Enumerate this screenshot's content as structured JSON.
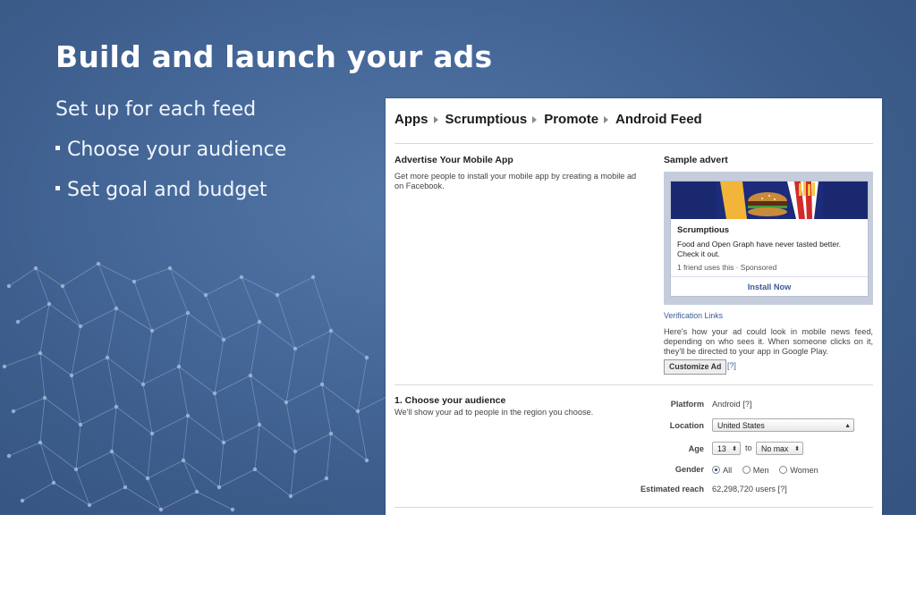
{
  "slide": {
    "title": "Build and launch your ads",
    "subtitle": "Set up for each feed",
    "bullets": [
      "Choose your audience",
      "Set goal and budget"
    ]
  },
  "screenshot": {
    "breadcrumb": [
      "Apps",
      "Scrumptious",
      "Promote",
      "Android Feed"
    ],
    "advertise": {
      "heading": "Advertise Your Mobile App",
      "description_line1": "Get more people to install your mobile app by creating a mobile ad",
      "description_line2": "on Facebook."
    },
    "sample": {
      "heading": "Sample advert",
      "ad_name": "Scrumptious",
      "ad_text_line1": "Food and Open Graph have never tasted better.",
      "ad_text_line2": "Check it out.",
      "ad_meta": "1 friend uses this · Sponsored",
      "install_label": "Install Now",
      "verification_link": "Verification Links",
      "explain_line1": "Here's how your ad could look in mobile news feed,",
      "explain_line2": "depending on who sees it. When someone clicks on it,",
      "explain_line3": "they'll be directed to your app in Google Play.",
      "customize_button": "Customize Ad",
      "customize_help": "[?]"
    },
    "audience": {
      "heading": "1. Choose your audience",
      "description": "We'll show your ad to people in the region you choose.",
      "platform_label": "Platform",
      "platform_value": "Android [?]",
      "location_label": "Location",
      "location_value": "United States",
      "age_label": "Age",
      "age_min": "13",
      "age_to": "to",
      "age_max": "No max",
      "gender_label": "Gender",
      "gender_options": [
        "All",
        "Men",
        "Women"
      ],
      "gender_selected": "All",
      "reach_label": "Estimated reach",
      "reach_value": "62,298,720 users [?]"
    }
  },
  "colors": {
    "slide_bg": "#46699a",
    "link": "#3b5998",
    "ad_banner": "#1c2b7a"
  }
}
